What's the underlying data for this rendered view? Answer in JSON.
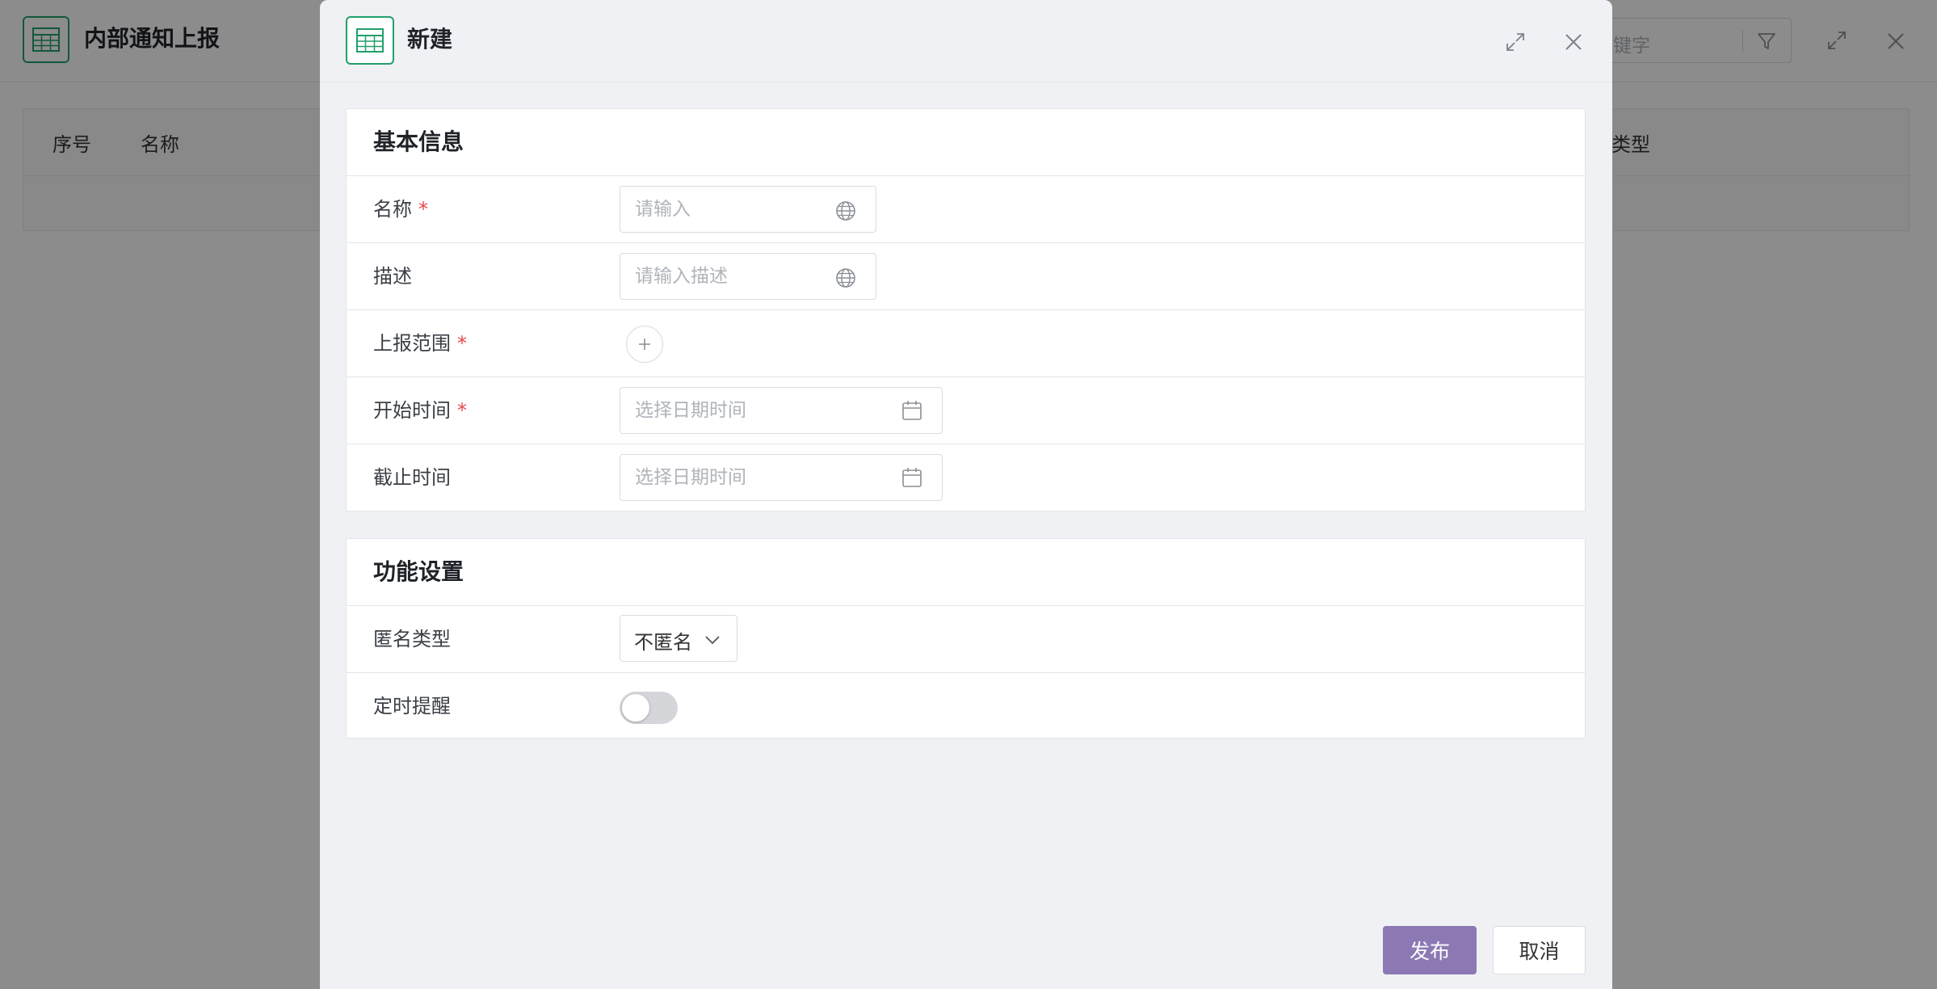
{
  "background": {
    "title": "内部通知上报",
    "search_placeholder": "键字",
    "table_columns": [
      "序号",
      "名称",
      "类型"
    ]
  },
  "modal": {
    "title": "新建",
    "section_basic": {
      "title": "基本信息",
      "fields": {
        "name": {
          "label": "名称",
          "placeholder": "请输入",
          "required_mark": "*"
        },
        "desc": {
          "label": "描述",
          "placeholder": "请输入描述"
        },
        "scope": {
          "label": "上报范围",
          "required_mark": "*"
        },
        "start": {
          "label": "开始时间",
          "placeholder": "选择日期时间",
          "required_mark": "*"
        },
        "end": {
          "label": "截止时间",
          "placeholder": "选择日期时间"
        }
      }
    },
    "section_func": {
      "title": "功能设置",
      "fields": {
        "anon": {
          "label": "匿名类型",
          "value": "不匿名"
        },
        "reminder": {
          "label": "定时提醒",
          "on": false
        }
      }
    },
    "buttons": {
      "publish": "发布",
      "cancel": "取消"
    }
  },
  "colors": {
    "brand_green": "#22a06b",
    "primary_button": "#8c79b4",
    "required": "#e5484d"
  }
}
